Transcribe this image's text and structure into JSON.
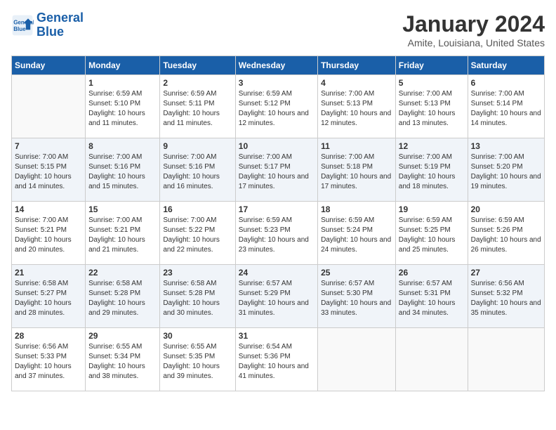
{
  "header": {
    "logo_line1": "General",
    "logo_line2": "Blue",
    "month": "January 2024",
    "location": "Amite, Louisiana, United States"
  },
  "days_of_week": [
    "Sunday",
    "Monday",
    "Tuesday",
    "Wednesday",
    "Thursday",
    "Friday",
    "Saturday"
  ],
  "weeks": [
    [
      {
        "day": "",
        "sunrise": "",
        "sunset": "",
        "daylight": ""
      },
      {
        "day": "1",
        "sunrise": "6:59 AM",
        "sunset": "5:10 PM",
        "daylight": "10 hours and 11 minutes."
      },
      {
        "day": "2",
        "sunrise": "6:59 AM",
        "sunset": "5:11 PM",
        "daylight": "10 hours and 11 minutes."
      },
      {
        "day": "3",
        "sunrise": "6:59 AM",
        "sunset": "5:12 PM",
        "daylight": "10 hours and 12 minutes."
      },
      {
        "day": "4",
        "sunrise": "7:00 AM",
        "sunset": "5:13 PM",
        "daylight": "10 hours and 12 minutes."
      },
      {
        "day": "5",
        "sunrise": "7:00 AM",
        "sunset": "5:13 PM",
        "daylight": "10 hours and 13 minutes."
      },
      {
        "day": "6",
        "sunrise": "7:00 AM",
        "sunset": "5:14 PM",
        "daylight": "10 hours and 14 minutes."
      }
    ],
    [
      {
        "day": "7",
        "sunrise": "7:00 AM",
        "sunset": "5:15 PM",
        "daylight": "10 hours and 14 minutes."
      },
      {
        "day": "8",
        "sunrise": "7:00 AM",
        "sunset": "5:16 PM",
        "daylight": "10 hours and 15 minutes."
      },
      {
        "day": "9",
        "sunrise": "7:00 AM",
        "sunset": "5:16 PM",
        "daylight": "10 hours and 16 minutes."
      },
      {
        "day": "10",
        "sunrise": "7:00 AM",
        "sunset": "5:17 PM",
        "daylight": "10 hours and 17 minutes."
      },
      {
        "day": "11",
        "sunrise": "7:00 AM",
        "sunset": "5:18 PM",
        "daylight": "10 hours and 17 minutes."
      },
      {
        "day": "12",
        "sunrise": "7:00 AM",
        "sunset": "5:19 PM",
        "daylight": "10 hours and 18 minutes."
      },
      {
        "day": "13",
        "sunrise": "7:00 AM",
        "sunset": "5:20 PM",
        "daylight": "10 hours and 19 minutes."
      }
    ],
    [
      {
        "day": "14",
        "sunrise": "7:00 AM",
        "sunset": "5:21 PM",
        "daylight": "10 hours and 20 minutes."
      },
      {
        "day": "15",
        "sunrise": "7:00 AM",
        "sunset": "5:21 PM",
        "daylight": "10 hours and 21 minutes."
      },
      {
        "day": "16",
        "sunrise": "7:00 AM",
        "sunset": "5:22 PM",
        "daylight": "10 hours and 22 minutes."
      },
      {
        "day": "17",
        "sunrise": "6:59 AM",
        "sunset": "5:23 PM",
        "daylight": "10 hours and 23 minutes."
      },
      {
        "day": "18",
        "sunrise": "6:59 AM",
        "sunset": "5:24 PM",
        "daylight": "10 hours and 24 minutes."
      },
      {
        "day": "19",
        "sunrise": "6:59 AM",
        "sunset": "5:25 PM",
        "daylight": "10 hours and 25 minutes."
      },
      {
        "day": "20",
        "sunrise": "6:59 AM",
        "sunset": "5:26 PM",
        "daylight": "10 hours and 26 minutes."
      }
    ],
    [
      {
        "day": "21",
        "sunrise": "6:58 AM",
        "sunset": "5:27 PM",
        "daylight": "10 hours and 28 minutes."
      },
      {
        "day": "22",
        "sunrise": "6:58 AM",
        "sunset": "5:28 PM",
        "daylight": "10 hours and 29 minutes."
      },
      {
        "day": "23",
        "sunrise": "6:58 AM",
        "sunset": "5:28 PM",
        "daylight": "10 hours and 30 minutes."
      },
      {
        "day": "24",
        "sunrise": "6:57 AM",
        "sunset": "5:29 PM",
        "daylight": "10 hours and 31 minutes."
      },
      {
        "day": "25",
        "sunrise": "6:57 AM",
        "sunset": "5:30 PM",
        "daylight": "10 hours and 33 minutes."
      },
      {
        "day": "26",
        "sunrise": "6:57 AM",
        "sunset": "5:31 PM",
        "daylight": "10 hours and 34 minutes."
      },
      {
        "day": "27",
        "sunrise": "6:56 AM",
        "sunset": "5:32 PM",
        "daylight": "10 hours and 35 minutes."
      }
    ],
    [
      {
        "day": "28",
        "sunrise": "6:56 AM",
        "sunset": "5:33 PM",
        "daylight": "10 hours and 37 minutes."
      },
      {
        "day": "29",
        "sunrise": "6:55 AM",
        "sunset": "5:34 PM",
        "daylight": "10 hours and 38 minutes."
      },
      {
        "day": "30",
        "sunrise": "6:55 AM",
        "sunset": "5:35 PM",
        "daylight": "10 hours and 39 minutes."
      },
      {
        "day": "31",
        "sunrise": "6:54 AM",
        "sunset": "5:36 PM",
        "daylight": "10 hours and 41 minutes."
      },
      {
        "day": "",
        "sunrise": "",
        "sunset": "",
        "daylight": ""
      },
      {
        "day": "",
        "sunrise": "",
        "sunset": "",
        "daylight": ""
      },
      {
        "day": "",
        "sunrise": "",
        "sunset": "",
        "daylight": ""
      }
    ]
  ],
  "labels": {
    "sunrise_prefix": "Sunrise: ",
    "sunset_prefix": "Sunset: ",
    "daylight_prefix": "Daylight: "
  }
}
